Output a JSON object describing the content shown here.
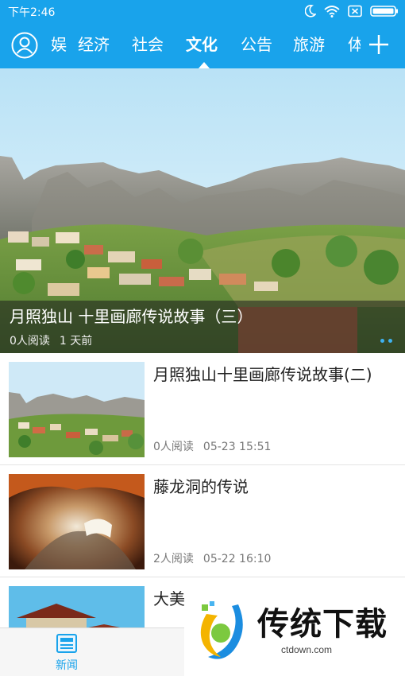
{
  "status_bar": {
    "time": "下午2:46"
  },
  "header": {
    "tabs": [
      {
        "label": "娱",
        "active": false
      },
      {
        "label": "经济",
        "active": false
      },
      {
        "label": "社会",
        "active": false
      },
      {
        "label": "文化",
        "active": true
      },
      {
        "label": "公告",
        "active": false
      },
      {
        "label": "旅游",
        "active": false
      },
      {
        "label": "体",
        "active": false
      }
    ],
    "accent_color": "#19a3eb",
    "left_icon": "user-icon",
    "right_icon": "plus-icon"
  },
  "banner": {
    "title": "月照独山 十里画廊传说故事（三）",
    "reads": "0人阅读",
    "time": "1 天前",
    "page_dots": 2
  },
  "articles": [
    {
      "title": "月照独山十里画廊传说故事(二)",
      "reads": "0人阅读",
      "time": "05-23 15:51",
      "thumb": "mountain-village"
    },
    {
      "title": "藤龙洞的传说",
      "reads": "2人阅读",
      "time": "05-22 16:10",
      "thumb": "cave"
    },
    {
      "title": "大美",
      "reads": "",
      "time": "",
      "thumb": "pagoda"
    }
  ],
  "bottom_nav": {
    "news_label": "新闻",
    "news_icon": "newspaper-icon"
  },
  "watermark": {
    "text": "传统下载",
    "sub": "ctdown.com"
  }
}
